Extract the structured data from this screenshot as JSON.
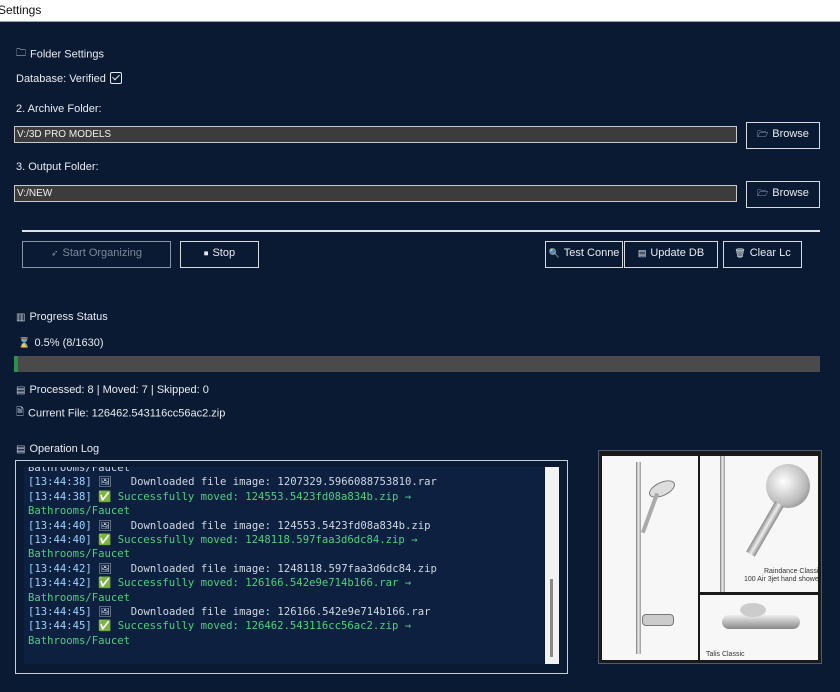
{
  "window": {
    "title": "Settings"
  },
  "folder_settings": {
    "heading": "Folder Settings",
    "heading_icon": "folder-icon",
    "database_status": "Database: Verified",
    "database_checked": true,
    "archive_label": "2. Archive Folder:",
    "archive_value": "V:/3D PRO MODELS",
    "output_label": "3. Output Folder:",
    "output_value": "V:/NEW",
    "browse_label": "Browse"
  },
  "actions": {
    "start": "Start Organizing",
    "stop": "Stop",
    "test": "Test Conne",
    "update": "Update DB",
    "clear": "Clear Lc"
  },
  "progress": {
    "heading": "Progress Status",
    "percent_text": "0.5% (8/1630)",
    "fraction": 0.005,
    "counts": "Processed: 8 | Moved: 7 | Skipped: 0",
    "current_file": "Current File: 126462.543116cc56ac2.zip"
  },
  "log": {
    "heading": "Operation Log",
    "lines": [
      {
        "type": "info",
        "text": "Bathrooms/Faucet"
      },
      {
        "type": "info",
        "ts": "[13:44:38]",
        "text": " 🖼   Downloaded file image: 1207329.5966088753810.rar"
      },
      {
        "type": "ok",
        "ts": "[13:44:38]",
        "text": " ✅ Successfully moved: 124553.5423fd08a834b.zip →"
      },
      {
        "type": "ok",
        "text": "Bathrooms/Faucet"
      },
      {
        "type": "info",
        "ts": "[13:44:40]",
        "text": " 🖼   Downloaded file image: 124553.5423fd08a834b.zip"
      },
      {
        "type": "ok",
        "ts": "[13:44:40]",
        "text": " ✅ Successfully moved: 1248118.597faa3d6dc84.zip →"
      },
      {
        "type": "ok",
        "text": "Bathrooms/Faucet"
      },
      {
        "type": "info",
        "ts": "[13:44:42]",
        "text": " 🖼   Downloaded file image: 1248118.597faa3d6dc84.zip"
      },
      {
        "type": "ok",
        "ts": "[13:44:42]",
        "text": " ✅ Successfully moved: 126166.542e9e714b166.rar →"
      },
      {
        "type": "ok",
        "text": "Bathrooms/Faucet"
      },
      {
        "type": "info",
        "ts": "[13:44:45]",
        "text": " 🖼   Downloaded file image: 126166.542e9e714b166.rar"
      },
      {
        "type": "ok",
        "ts": "[13:44:45]",
        "text": " ✅ Successfully moved: 126462.543116cc56ac2.zip →"
      },
      {
        "type": "ok",
        "text": "Bathrooms/Faucet"
      }
    ]
  },
  "preview": {
    "caption1": "Raindance Classi",
    "caption2": "100 Air 3jet hand showe",
    "caption3": "Talis Classic"
  }
}
